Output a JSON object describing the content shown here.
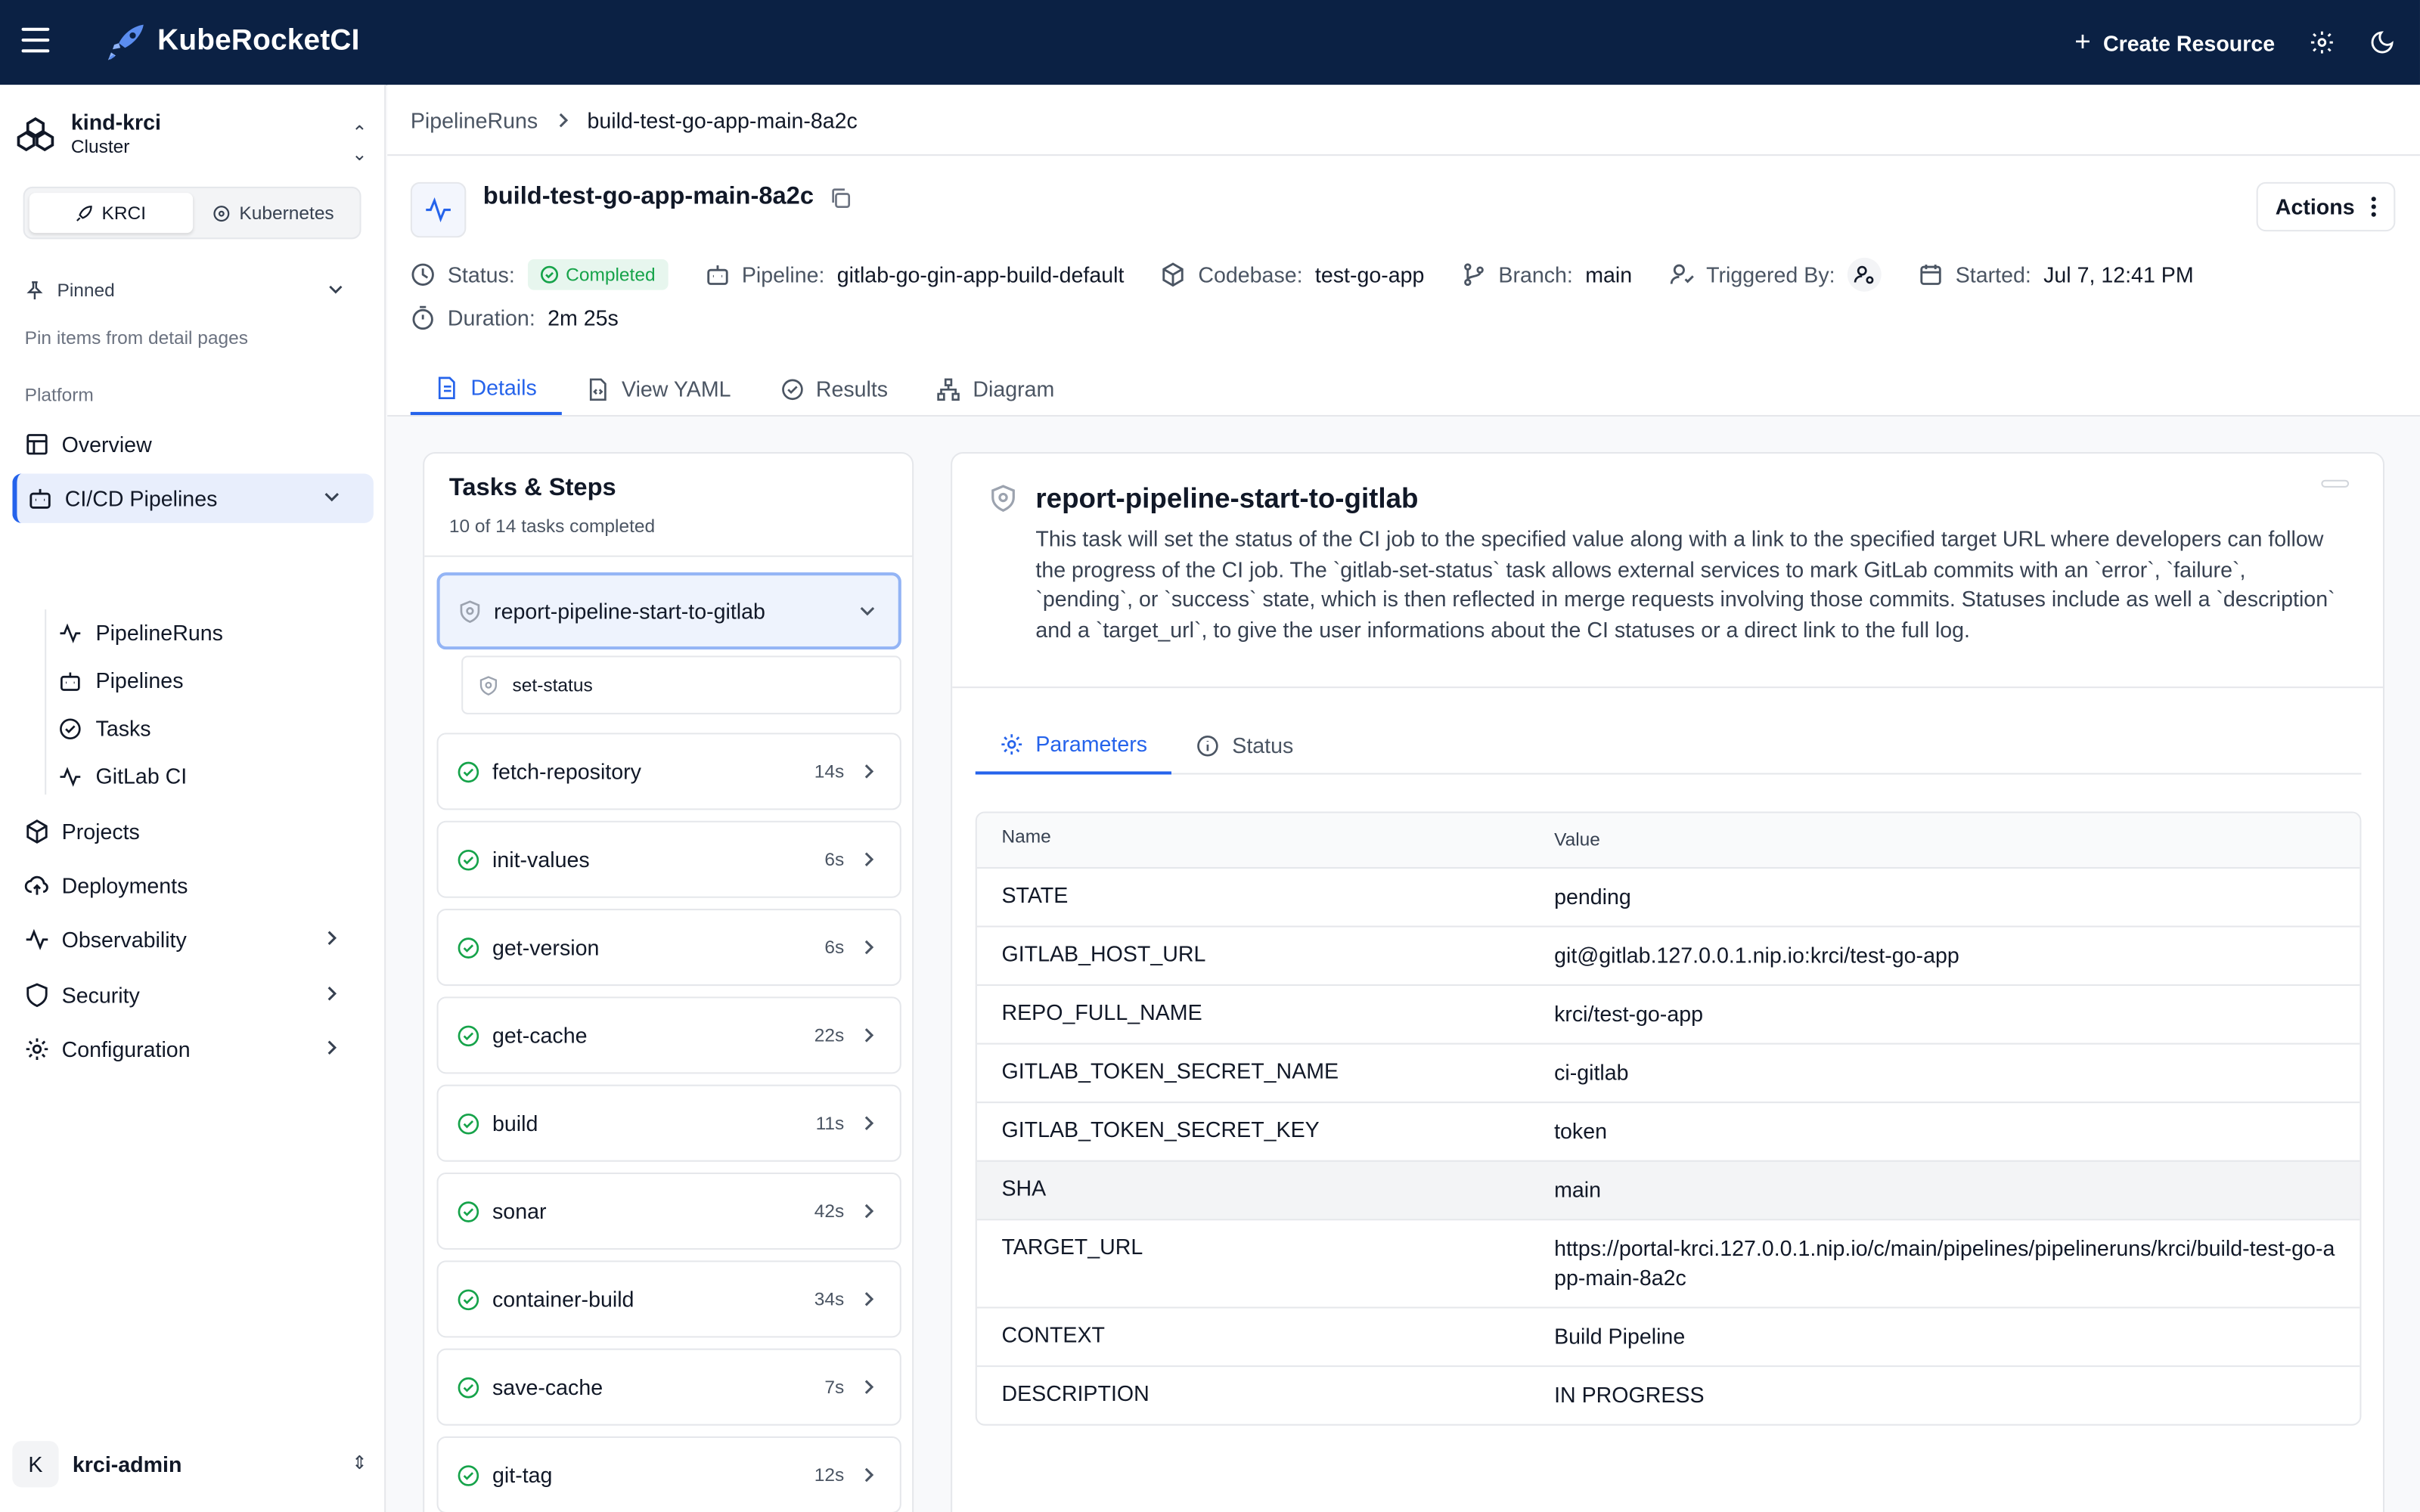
{
  "topbar": {
    "app_name": "KubeRocketCI",
    "create_label": "Create Resource"
  },
  "sidebar": {
    "cluster_name": "kind-krci",
    "cluster_type": "Cluster",
    "segments": [
      "KRCI",
      "Kubernetes"
    ],
    "pinned_label": "Pinned",
    "pinned_hint": "Pin items from detail pages",
    "section_label": "Platform",
    "items": [
      {
        "label": "Overview",
        "icon": "overview-icon"
      },
      {
        "label": "CI/CD Pipelines",
        "icon": "pipeline-icon"
      },
      {
        "label": "Projects",
        "icon": "box-icon"
      },
      {
        "label": "Deployments",
        "icon": "cloud-upload-icon"
      },
      {
        "label": "Observability",
        "icon": "activity-icon"
      },
      {
        "label": "Security",
        "icon": "shield-icon"
      },
      {
        "label": "Configuration",
        "icon": "gear-icon"
      }
    ],
    "subitems": [
      "PipelineRuns",
      "Pipelines",
      "Tasks",
      "GitLab CI"
    ],
    "user_initial": "K",
    "user_name": "krci-admin"
  },
  "breadcrumb": {
    "parent": "PipelineRuns",
    "current": "build-test-go-app-main-8a2c"
  },
  "run": {
    "title": "build-test-go-app-main-8a2c",
    "actions_label": "Actions",
    "status_label": "Status:",
    "status_value": "Completed",
    "pipeline_label": "Pipeline:",
    "pipeline_value": "gitlab-go-gin-app-build-default",
    "codebase_label": "Codebase:",
    "codebase_value": "test-go-app",
    "branch_label": "Branch:",
    "branch_value": "main",
    "triggered_label": "Triggered By:",
    "started_label": "Started:",
    "started_value": "Jul 7, 12:41 PM",
    "duration_label": "Duration:",
    "duration_value": "2m 25s"
  },
  "tabs": [
    "Details",
    "View YAML",
    "Results",
    "Diagram"
  ],
  "tasks_panel": {
    "title": "Tasks & Steps",
    "subtitle": "10 of 14 tasks completed",
    "selected_task": "report-pipeline-start-to-gitlab",
    "selected_step": "set-status",
    "tasks": [
      {
        "name": "fetch-repository",
        "duration": "14s"
      },
      {
        "name": "init-values",
        "duration": "6s"
      },
      {
        "name": "get-version",
        "duration": "6s"
      },
      {
        "name": "get-cache",
        "duration": "22s"
      },
      {
        "name": "build",
        "duration": "11s"
      },
      {
        "name": "sonar",
        "duration": "42s"
      },
      {
        "name": "container-build",
        "duration": "34s"
      },
      {
        "name": "save-cache",
        "duration": "7s"
      },
      {
        "name": "git-tag",
        "duration": "12s"
      }
    ]
  },
  "detail": {
    "title": "report-pipeline-start-to-gitlab",
    "description": "This task will set the status of the CI job to the specified value along with a link to the specified target URL where developers can follow the progress of the CI job. The `gitlab-set-status` task allows external services to mark GitLab commits with an `error`, `failure`, `pending`, or `success` state, which is then reflected in merge requests involving those commits. Statuses include as well a `description` and a `target_url`, to give the user informations about the CI statuses or a direct link to the full log.",
    "tabs": [
      "Parameters",
      "Status"
    ],
    "table_headers": [
      "Name",
      "Value"
    ],
    "params": [
      {
        "name": "STATE",
        "value": "pending"
      },
      {
        "name": "GITLAB_HOST_URL",
        "value": "git@gitlab.127.0.0.1.nip.io:krci/test-go-app"
      },
      {
        "name": "REPO_FULL_NAME",
        "value": "krci/test-go-app"
      },
      {
        "name": "GITLAB_TOKEN_SECRET_NAME",
        "value": "ci-gitlab"
      },
      {
        "name": "GITLAB_TOKEN_SECRET_KEY",
        "value": "token"
      },
      {
        "name": "SHA",
        "value": "main"
      },
      {
        "name": "TARGET_URL",
        "value": "https://portal-krci.127.0.0.1.nip.io/c/main/pipelines/pipelineruns/krci/build-test-go-app-main-8a2c"
      },
      {
        "name": "CONTEXT",
        "value": "Build Pipeline"
      },
      {
        "name": "DESCRIPTION",
        "value": "IN PROGRESS"
      }
    ]
  },
  "colors": {
    "topbar": "#0b2144",
    "accent": "#2563eb",
    "success": "#16a34a"
  }
}
